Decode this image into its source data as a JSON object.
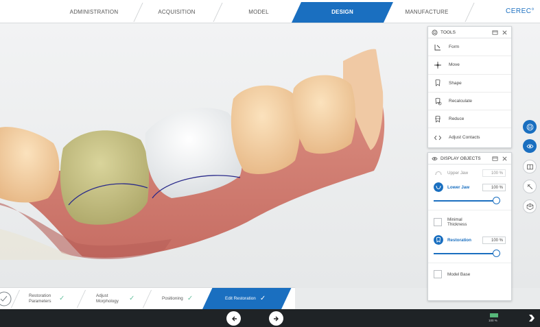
{
  "nav": {
    "steps": [
      "ADMINISTRATION",
      "ACQUISITION",
      "MODEL",
      "DESIGN",
      "MANUFACTURE"
    ],
    "active": "DESIGN",
    "brand": "CEREC°"
  },
  "colors": {
    "accent": "#1a6fc0",
    "check": "#6cc3a2",
    "bar": "#1f2326"
  },
  "tools_panel": {
    "title": "TOOLS",
    "items": [
      "Form",
      "Move",
      "Shape",
      "Recalculate",
      "Reduce",
      "Adjust Contacts"
    ]
  },
  "display_panel": {
    "title": "DISPLAY OBJECTS",
    "upper_jaw": {
      "label": "Upper Jaw",
      "value": "100 %"
    },
    "lower_jaw": {
      "label": "Lower Jaw",
      "value": "100 %"
    },
    "lower_jaw_level": 1.0,
    "minimal_thickness": "Minimal Thickness",
    "restoration": {
      "label": "Restoration",
      "value": "100 %"
    },
    "restoration_level": 1.0,
    "model_base": "Model Base"
  },
  "side_buttons": [
    "tooth-icon",
    "eye-icon",
    "jaw-icon",
    "split-icon",
    "cube-icon"
  ],
  "workflow": {
    "steps": [
      {
        "label": "Restoration Parameters",
        "done": true
      },
      {
        "label": "Adjust Morphology",
        "done": true
      },
      {
        "label": "Positioning",
        "done": true
      },
      {
        "label": "Edit Restoration",
        "done": true
      }
    ],
    "active": "Edit Restoration",
    "check": "✓"
  },
  "status": {
    "indicator": "100 %"
  }
}
